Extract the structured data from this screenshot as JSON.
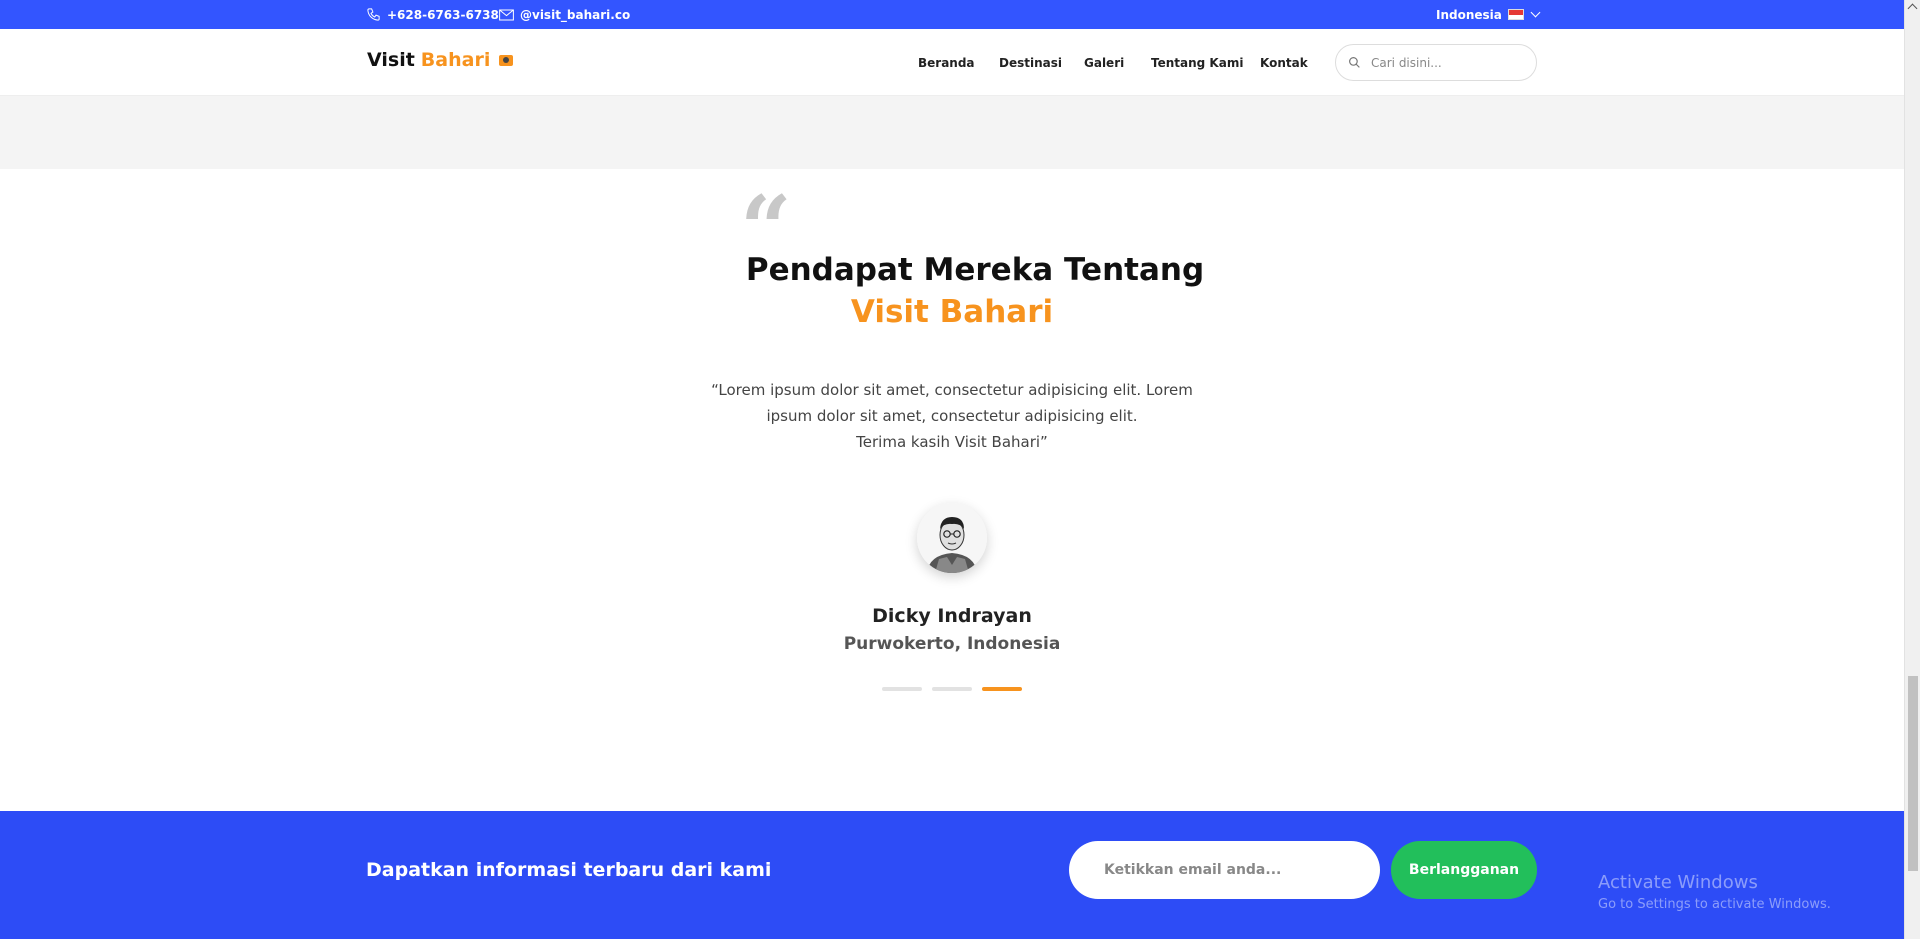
{
  "topbar": {
    "phone": "+628-6763-6738",
    "email": "@visit_bahari.co",
    "language": "Indonesia"
  },
  "navbar": {
    "logo_text": "Visit",
    "logo_accent": "Bahari",
    "nav_items": [
      "Beranda",
      "Destinasi",
      "Galeri",
      "Tentang Kami",
      "Kontak"
    ],
    "search_placeholder": "Cari disini..."
  },
  "testimonial": {
    "heading_line1": "Pendapat Mereka Tentang",
    "heading_line2": "Visit Bahari",
    "quote_line1": "“Lorem ipsum dolor sit amet, consectetur adipisicing elit. Lorem",
    "quote_line2": "ipsum dolor sit amet, consectetur adipisicing elit.",
    "quote_line3": "Terima kasih Visit Bahari”",
    "person_name": "Dicky Indrayan",
    "person_location": "Purwokerto, Indonesia",
    "slides_total": 3,
    "active_slide": 3
  },
  "newsletter": {
    "title": "Dapatkan informasi terbaru dari kami",
    "email_placeholder": "Ketikkan email anda...",
    "button_label": "Berlangganan"
  },
  "watermark": {
    "line1": "Activate Windows",
    "line2": "Go to Settings to activate Windows."
  },
  "colors": {
    "primary_blue": "#3355ff",
    "accent_orange": "#f7931e",
    "subscribe_green": "#22bf5b"
  }
}
